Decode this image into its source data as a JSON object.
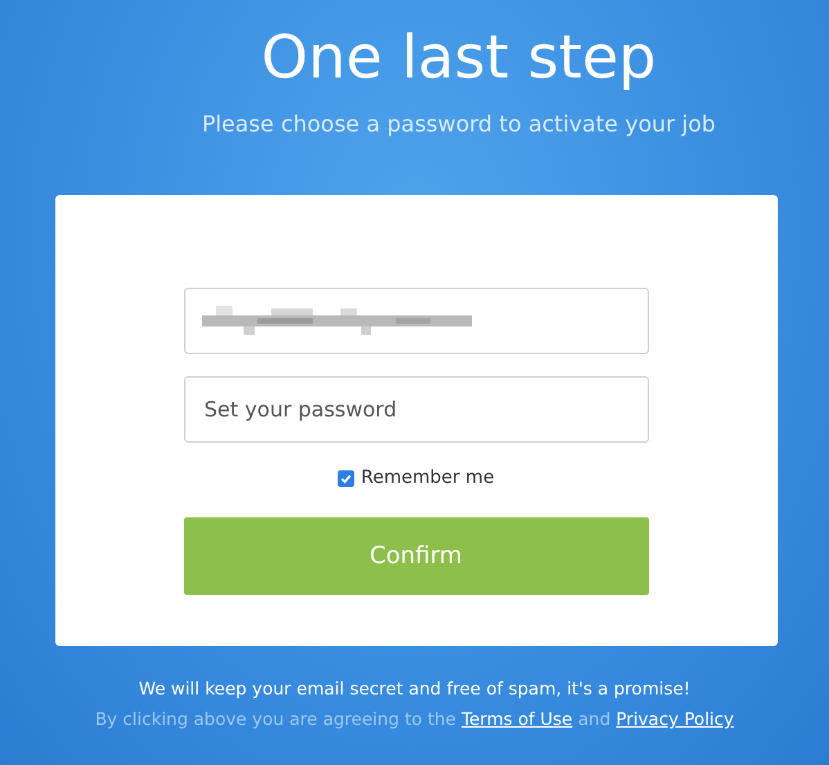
{
  "title": "One last step",
  "subtitle": "Please choose a password to activate your job",
  "email_field": {
    "value_redacted": true
  },
  "password_field": {
    "placeholder": "Set your password"
  },
  "remember": {
    "label": "Remember me",
    "checked": true
  },
  "confirm_button": "Confirm",
  "footer": {
    "promise": "We will keep your email secret and free of spam, it's a promise!",
    "agreement_prefix": "By clicking above you are agreeing to the",
    "links": [
      "Terms of Use",
      "Privacy Policy"
    ],
    "joiner": "and"
  }
}
